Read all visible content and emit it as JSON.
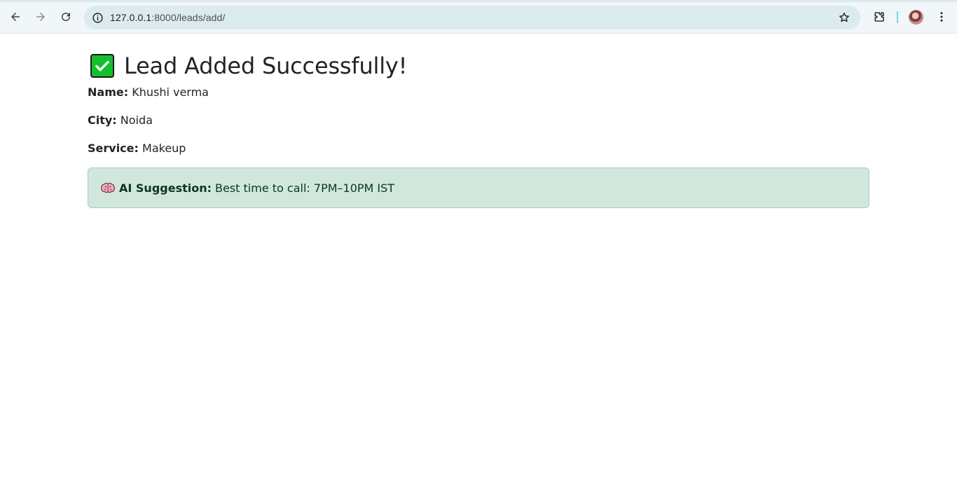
{
  "browser": {
    "url_host": "127.0.0.1",
    "url_path": ":8000/leads/add/",
    "icons": {
      "back": "back-arrow-icon",
      "forward": "forward-arrow-icon",
      "reload": "reload-icon",
      "site_info": "info-icon",
      "bookmark": "star-icon",
      "extensions": "puzzle-icon",
      "profile": "avatar",
      "menu": "kebab-menu-icon"
    }
  },
  "page": {
    "heading": "Lead Added Successfully!",
    "heading_icon": "check-mark-icon",
    "fields": [
      {
        "label": "Name:",
        "value": "Khushi verma"
      },
      {
        "label": "City:",
        "value": "Noida"
      },
      {
        "label": "Service:",
        "value": "Makeup"
      }
    ],
    "suggestion": {
      "icon": "brain-icon",
      "label": "AI Suggestion:",
      "text": "Best time to call: 7PM–10PM IST"
    }
  },
  "colors": {
    "success_check": "#13c02b",
    "alert_bg": "#d1e7dd",
    "alert_border": "#a3cfbb",
    "alert_text": "#0a3622"
  }
}
